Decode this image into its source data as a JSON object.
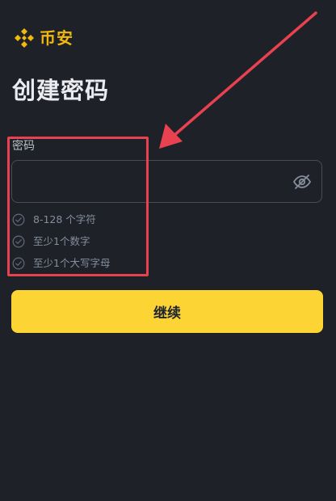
{
  "brand": {
    "name": "币安",
    "logo_icon": "binance-diamond-logo",
    "color": "#f0b90b"
  },
  "page": {
    "title": "创建密码"
  },
  "password_field": {
    "label": "密码",
    "value": "",
    "placeholder": "",
    "toggle_icon": "eye-slash-icon"
  },
  "rules": [
    {
      "text": "8-128 个字符",
      "icon": "check-circle-icon",
      "met": false
    },
    {
      "text": "至少1个数字",
      "icon": "check-circle-icon",
      "met": false
    },
    {
      "text": "至少1个大写字母",
      "icon": "check-circle-icon",
      "met": false
    }
  ],
  "actions": {
    "continue_label": "继续",
    "continue_color": "#fcd535"
  },
  "annotation": {
    "highlight_color": "#e8414f"
  }
}
